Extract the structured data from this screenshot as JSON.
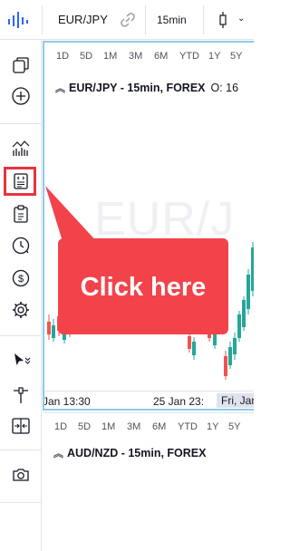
{
  "toolbar": {
    "symbol": "EUR/JPY",
    "interval": "15min",
    "icons": [
      "logo-icon",
      "link-icon",
      "candlestick-icon",
      "chevron-down-icon"
    ]
  },
  "left_toolbar": {
    "tools": [
      "layout-icon",
      "add-icon",
      "indicators-icon",
      "script-editor-icon",
      "clipboard-icon",
      "alert-clock-icon",
      "dollar-icon",
      "settings-gear-icon",
      "cursor-icon",
      "crosshair-icon",
      "compare-icon",
      "camera-icon"
    ],
    "highlight_color": "#e8343d"
  },
  "pane1": {
    "ranges": [
      "1D",
      "5D",
      "1M",
      "3M",
      "6M",
      "YTD",
      "1Y",
      "5Y"
    ],
    "legend": "EUR/JPY - 15min, FOREX",
    "ohlc_label": "O: 16",
    "watermark": "EUR/J",
    "time_labels": [
      "Jan 13:30",
      "25 Jan 23:",
      "Fri, Jan"
    ]
  },
  "pane2": {
    "ranges": [
      "1D",
      "5D",
      "1M",
      "3M",
      "6M",
      "YTD",
      "1Y",
      "5Y"
    ],
    "legend": "AUD/NZD - 15min, FOREX"
  },
  "callout": {
    "text": "Click here",
    "color": "#f2434b"
  },
  "colors": {
    "up": "#26a69a",
    "down": "#ef5350",
    "accent": "#2962ff"
  }
}
